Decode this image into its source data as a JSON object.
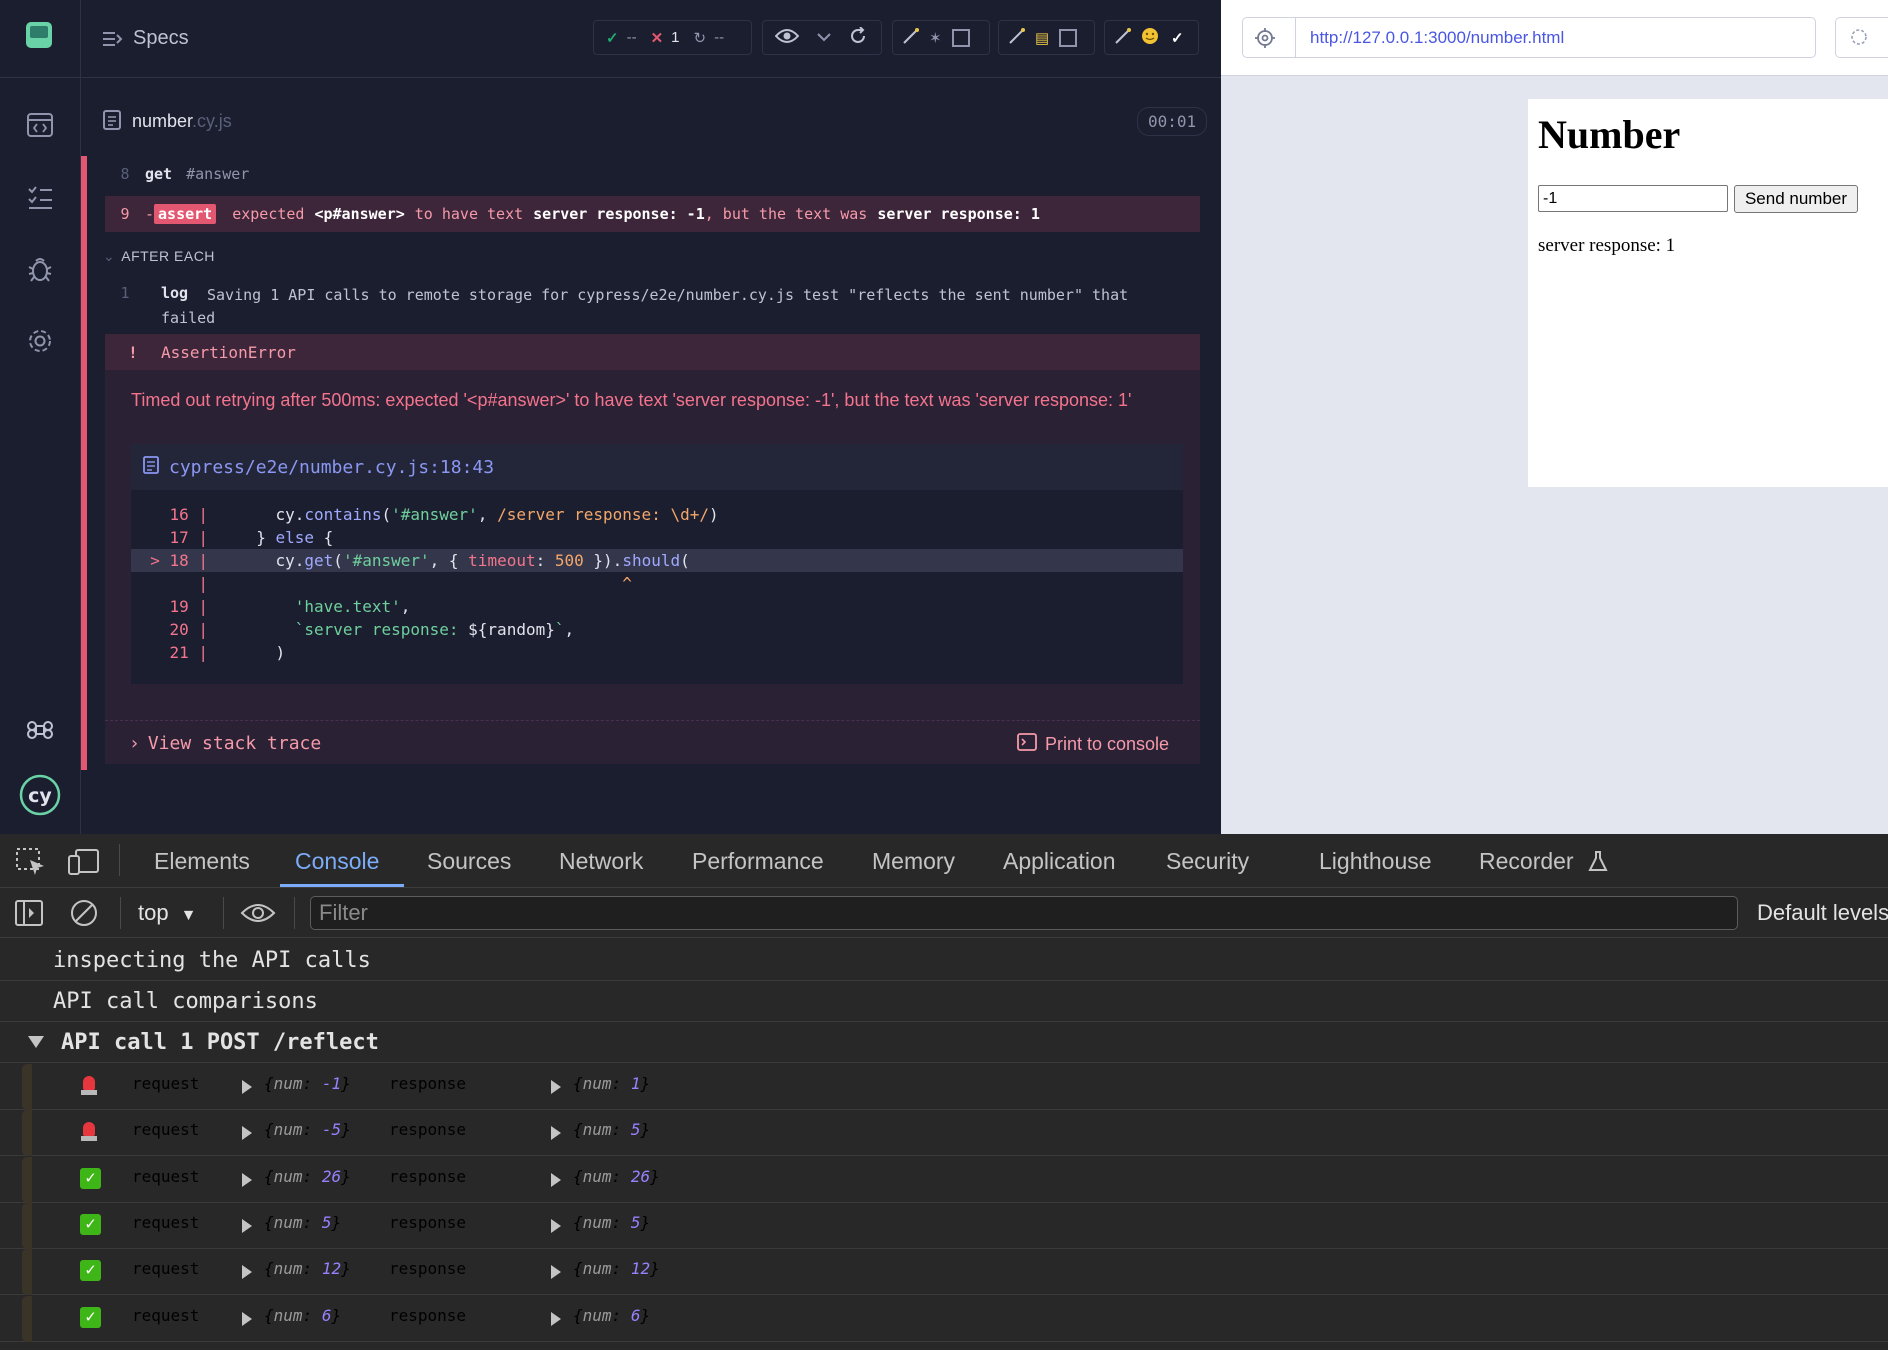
{
  "reporter": {
    "specs_title": "Specs",
    "stats": {
      "passed": "--",
      "failed": "1",
      "pending": "--"
    },
    "spec_file": {
      "name": "number",
      "ext": ".cy.js",
      "duration": "00:01"
    },
    "commands": [
      {
        "num": "8",
        "name": "get",
        "message": "#answer"
      }
    ],
    "failed_command": {
      "num": "9",
      "prefix": "-",
      "name": "assert",
      "parts": [
        "expected",
        "<p#answer>",
        "to have text",
        "server response: -1",
        ", but the text was",
        "server response: 1"
      ]
    },
    "after_each_label": "AFTER EACH",
    "log_command": {
      "num": "1",
      "name": "log",
      "message": "Saving 1 API calls to remote storage for cypress/e2e/number.cy.js test \"reflects the sent number\" that failed"
    },
    "error": {
      "bang": "!",
      "name": "AssertionError",
      "message": "Timed out retrying after 500ms: expected '<p#answer>' to have text 'server response: -1', but the text was 'server response: 1'",
      "code_file": "cypress/e2e/number.cy.js:18:43",
      "view_stack_trace": "View stack trace",
      "print_to_console": "Print to console"
    }
  },
  "aut": {
    "url": "http://127.0.0.1:3000/number.html",
    "page_title": "Number",
    "input_value": "-1",
    "send_button": "Send number",
    "answer": "server response: 1"
  },
  "devtools": {
    "tabs": [
      "Elements",
      "Console",
      "Sources",
      "Network",
      "Performance",
      "Memory",
      "Application",
      "Security",
      "Lighthouse",
      "Recorder"
    ],
    "active_tab": "Console",
    "context": "top",
    "filter_placeholder": "Filter",
    "default_levels": "Default levels",
    "console_lines": [
      "inspecting the API calls",
      "API call comparisons"
    ],
    "group_label": "API call 1 POST /reflect",
    "request_label": "request",
    "response_label": "response",
    "api_rows": [
      {
        "status": "fail",
        "request_num": "-1",
        "response_num": "1"
      },
      {
        "status": "fail",
        "request_num": "-5",
        "response_num": "5"
      },
      {
        "status": "pass",
        "request_num": "26",
        "response_num": "26"
      },
      {
        "status": "pass",
        "request_num": "5",
        "response_num": "5"
      },
      {
        "status": "pass",
        "request_num": "12",
        "response_num": "12"
      },
      {
        "status": "pass",
        "request_num": "6",
        "response_num": "6"
      }
    ]
  },
  "colors": {
    "fail": "#e45770",
    "pass": "#3fb618",
    "accent": "#7cacf8",
    "url": "#4956e3"
  }
}
